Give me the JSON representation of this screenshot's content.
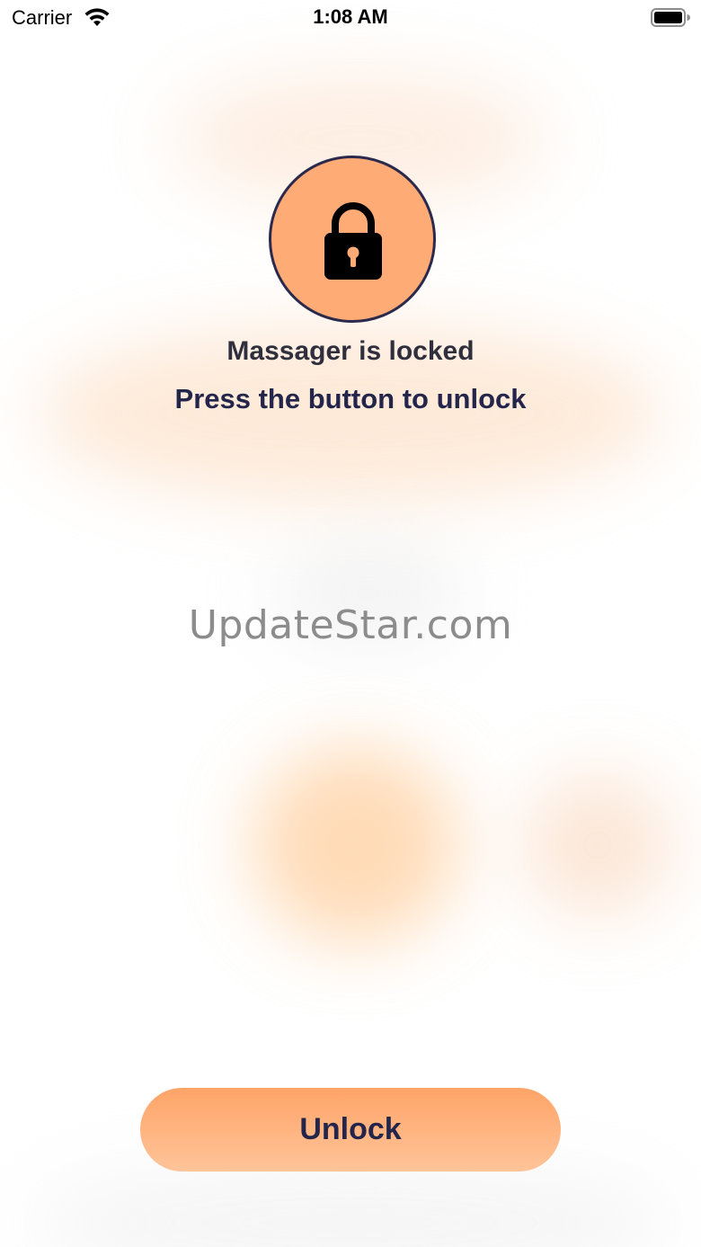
{
  "status_bar": {
    "carrier": "Carrier",
    "time": "1:08 AM",
    "wifi_icon": "wifi-icon",
    "battery_icon": "battery-full-icon"
  },
  "lock_screen": {
    "icon": "padlock-icon",
    "icon_circle_color": "#ffab76",
    "title": "Massager is locked",
    "subtitle": "Press the button to unlock"
  },
  "watermark": "UpdateStar.com",
  "unlock_button": {
    "label": "Unlock",
    "color": "#ffa468"
  }
}
